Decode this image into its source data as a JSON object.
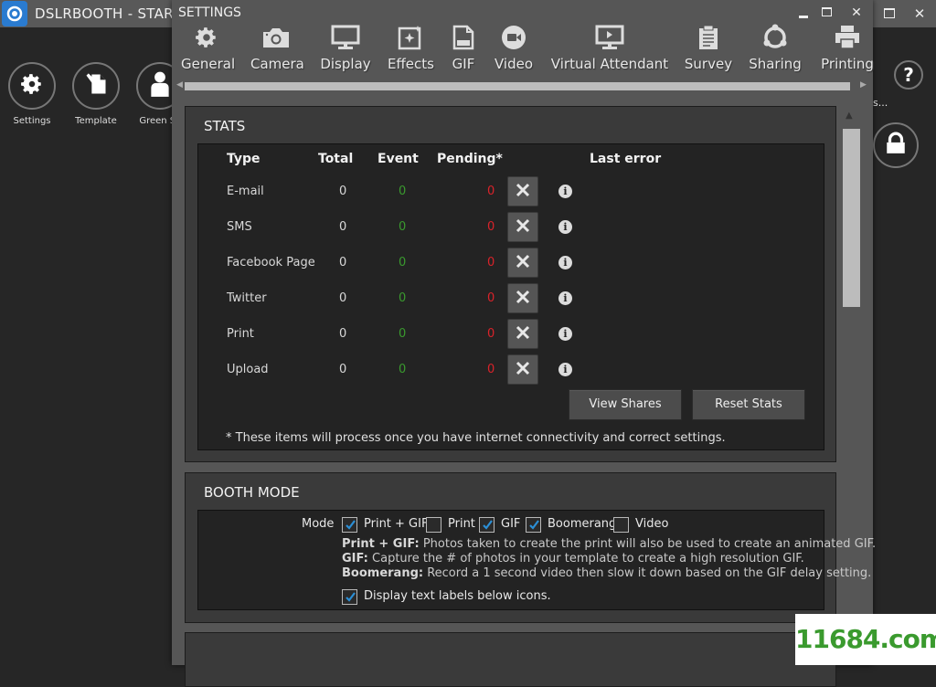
{
  "main_window": {
    "title": "DSLRBOOTH - START",
    "toolbar": [
      {
        "label": "Settings",
        "icon": "gear-icon"
      },
      {
        "label": "Template",
        "icon": "template-edit-icon"
      },
      {
        "label": "Green Sc",
        "icon": "person-icon"
      }
    ],
    "truncated_label": "s...",
    "help_icon": "question-icon",
    "lock_icon": "lock-icon"
  },
  "settings_window": {
    "title": "SETTINGS",
    "tabs": [
      {
        "label": "General",
        "icon": "gear-icon"
      },
      {
        "label": "Camera",
        "icon": "camera-icon"
      },
      {
        "label": "Display",
        "icon": "monitor-icon"
      },
      {
        "label": "Effects",
        "icon": "effects-sparkle-icon"
      },
      {
        "label": "GIF",
        "icon": "gif-file-icon"
      },
      {
        "label": "Video",
        "icon": "video-icon"
      },
      {
        "label": "Virtual Attendant",
        "icon": "virtual-attendant-icon"
      },
      {
        "label": "Survey",
        "icon": "clipboard-icon"
      },
      {
        "label": "Sharing",
        "icon": "share-icon"
      },
      {
        "label": "Printing",
        "icon": "printer-icon"
      }
    ],
    "stats": {
      "title": "STATS",
      "headers": {
        "type": "Type",
        "total": "Total",
        "event": "Event",
        "pending": "Pending*",
        "last_error": "Last error"
      },
      "rows": [
        {
          "type": "E-mail",
          "total": "0",
          "event": "0",
          "pending": "0",
          "last_error": ""
        },
        {
          "type": "SMS",
          "total": "0",
          "event": "0",
          "pending": "0",
          "last_error": ""
        },
        {
          "type": "Facebook Page",
          "total": "0",
          "event": "0",
          "pending": "0",
          "last_error": ""
        },
        {
          "type": "Twitter",
          "total": "0",
          "event": "0",
          "pending": "0",
          "last_error": ""
        },
        {
          "type": "Print",
          "total": "0",
          "event": "0",
          "pending": "0",
          "last_error": ""
        },
        {
          "type": "Upload",
          "total": "0",
          "event": "0",
          "pending": "0",
          "last_error": ""
        }
      ],
      "view_shares_label": "View Shares",
      "reset_stats_label": "Reset Stats",
      "footnote": "* These items will process once you have internet connectivity and correct settings."
    },
    "booth_mode": {
      "title": "BOOTH MODE",
      "mode_label": "Mode",
      "options": [
        {
          "label": "Print + GIF",
          "checked": true
        },
        {
          "label": "Print",
          "checked": false
        },
        {
          "label": "GIF",
          "checked": true
        },
        {
          "label": "Boomerang",
          "checked": true
        },
        {
          "label": "Video",
          "checked": false
        }
      ],
      "descriptions": [
        {
          "term": "Print + GIF:",
          "text": " Photos taken to create the print will also be used to create an animated GIF."
        },
        {
          "term": "GIF:",
          "text": " Capture the # of photos in your template to create a high resolution GIF."
        },
        {
          "term": "Boomerang:",
          "text": " Record a 1 second video then slow it down based on the GIF delay setting."
        }
      ],
      "display_labels": {
        "label": "Display text labels below icons.",
        "checked": true
      }
    }
  },
  "colors": {
    "event_count": "#3a9a2e",
    "pending_count": "#d9232a",
    "checkbox_tick": "#2b8fd6",
    "window_bg": "#565656",
    "panel_bg": "#232323"
  },
  "watermark": "11684.com"
}
